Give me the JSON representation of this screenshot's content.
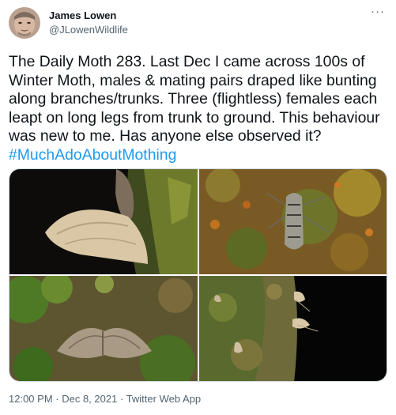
{
  "user": {
    "name": "James Lowen",
    "handle": "@JLowenWildlife"
  },
  "menu": {
    "more_label": "···"
  },
  "tweet": {
    "text": "The Daily Moth 283. Last Dec I came across 100s of Winter Moth, males & mating pairs draped like bunting along branches/trunks. Three (flightless) females each leapt on long legs from trunk to ground. This behaviour was new to me. Has anyone else observed it? ",
    "hashtag": "#MuchAdoAboutMothing"
  },
  "media": {
    "photos": [
      {
        "icon": "moth-photo"
      },
      {
        "icon": "moth-photo"
      },
      {
        "icon": "moth-photo"
      },
      {
        "icon": "moth-photo"
      }
    ]
  },
  "meta": {
    "time": "12:00 PM",
    "separator": " · ",
    "date": "Dec 8, 2021",
    "source": "Twitter Web App"
  },
  "colors": {
    "link": "#1d9bf0",
    "secondary_text": "#536471",
    "text": "#0f1419"
  }
}
